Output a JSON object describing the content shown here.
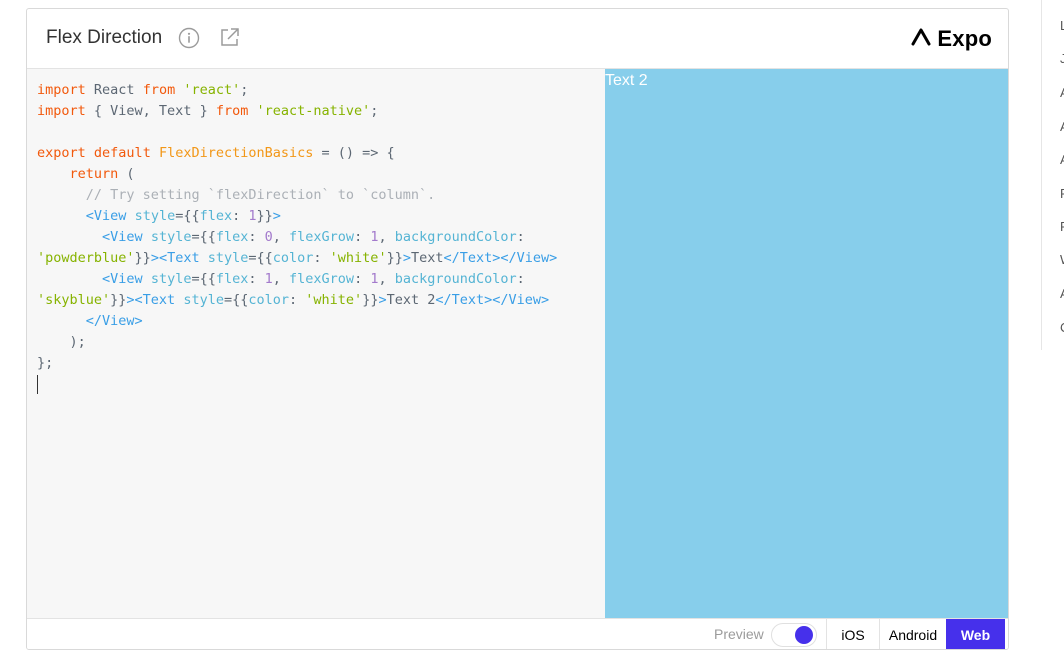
{
  "header": {
    "title": "Flex Direction",
    "brand": "Expo"
  },
  "code": {
    "lines": [
      [
        {
          "t": "import",
          "c": "kw"
        },
        {
          "t": " React ",
          "c": ""
        },
        {
          "t": "from",
          "c": "kw"
        },
        {
          "t": " ",
          "c": ""
        },
        {
          "t": "'react'",
          "c": "str"
        },
        {
          "t": ";",
          "c": ""
        }
      ],
      [
        {
          "t": "import",
          "c": "kw"
        },
        {
          "t": " { View, Text } ",
          "c": ""
        },
        {
          "t": "from",
          "c": "kw"
        },
        {
          "t": " ",
          "c": ""
        },
        {
          "t": "'react-native'",
          "c": "str"
        },
        {
          "t": ";",
          "c": ""
        }
      ],
      [],
      [
        {
          "t": "export",
          "c": "kw"
        },
        {
          "t": " ",
          "c": ""
        },
        {
          "t": "default",
          "c": "kw"
        },
        {
          "t": " ",
          "c": ""
        },
        {
          "t": "FlexDirectionBasics",
          "c": "fn"
        },
        {
          "t": " = () => {",
          "c": ""
        }
      ],
      [
        {
          "t": "    ",
          "c": ""
        },
        {
          "t": "return",
          "c": "kw"
        },
        {
          "t": " (",
          "c": ""
        }
      ],
      [
        {
          "t": "      ",
          "c": ""
        },
        {
          "t": "// Try setting `flexDirection` to `column`.",
          "c": "com"
        }
      ],
      [
        {
          "t": "      ",
          "c": ""
        },
        {
          "t": "<View",
          "c": "tag"
        },
        {
          "t": " ",
          "c": ""
        },
        {
          "t": "style",
          "c": "attr"
        },
        {
          "t": "={{",
          "c": ""
        },
        {
          "t": "flex",
          "c": "attr"
        },
        {
          "t": ": ",
          "c": ""
        },
        {
          "t": "1",
          "c": "num"
        },
        {
          "t": "}}",
          "c": ""
        },
        {
          "t": ">",
          "c": "tag"
        }
      ],
      [
        {
          "t": "        ",
          "c": ""
        },
        {
          "t": "<View",
          "c": "tag"
        },
        {
          "t": " ",
          "c": ""
        },
        {
          "t": "style",
          "c": "attr"
        },
        {
          "t": "={{",
          "c": ""
        },
        {
          "t": "flex",
          "c": "attr"
        },
        {
          "t": ": ",
          "c": ""
        },
        {
          "t": "0",
          "c": "num"
        },
        {
          "t": ", ",
          "c": ""
        },
        {
          "t": "flexGrow",
          "c": "attr"
        },
        {
          "t": ": ",
          "c": ""
        },
        {
          "t": "1",
          "c": "num"
        },
        {
          "t": ", ",
          "c": ""
        },
        {
          "t": "backgroundColor",
          "c": "attr"
        },
        {
          "t": ":",
          "c": ""
        }
      ],
      [
        {
          "t": "'powderblue'",
          "c": "str"
        },
        {
          "t": "}}",
          "c": ""
        },
        {
          "t": "><Text",
          "c": "tag"
        },
        {
          "t": " ",
          "c": ""
        },
        {
          "t": "style",
          "c": "attr"
        },
        {
          "t": "={{",
          "c": ""
        },
        {
          "t": "color",
          "c": "attr"
        },
        {
          "t": ": ",
          "c": ""
        },
        {
          "t": "'white'",
          "c": "str"
        },
        {
          "t": "}}",
          "c": ""
        },
        {
          "t": ">",
          "c": "tag"
        },
        {
          "t": "Text",
          "c": ""
        },
        {
          "t": "</Text></View>",
          "c": "tag"
        }
      ],
      [
        {
          "t": "        ",
          "c": ""
        },
        {
          "t": "<View",
          "c": "tag"
        },
        {
          "t": " ",
          "c": ""
        },
        {
          "t": "style",
          "c": "attr"
        },
        {
          "t": "={{",
          "c": ""
        },
        {
          "t": "flex",
          "c": "attr"
        },
        {
          "t": ": ",
          "c": ""
        },
        {
          "t": "1",
          "c": "num"
        },
        {
          "t": ", ",
          "c": ""
        },
        {
          "t": "flexGrow",
          "c": "attr"
        },
        {
          "t": ": ",
          "c": ""
        },
        {
          "t": "1",
          "c": "num"
        },
        {
          "t": ", ",
          "c": ""
        },
        {
          "t": "backgroundColor",
          "c": "attr"
        },
        {
          "t": ":",
          "c": ""
        }
      ],
      [
        {
          "t": "'skyblue'",
          "c": "str"
        },
        {
          "t": "}}",
          "c": ""
        },
        {
          "t": "><Text",
          "c": "tag"
        },
        {
          "t": " ",
          "c": ""
        },
        {
          "t": "style",
          "c": "attr"
        },
        {
          "t": "={{",
          "c": ""
        },
        {
          "t": "color",
          "c": "attr"
        },
        {
          "t": ": ",
          "c": ""
        },
        {
          "t": "'white'",
          "c": "str"
        },
        {
          "t": "}}",
          "c": ""
        },
        {
          "t": ">",
          "c": "tag"
        },
        {
          "t": "Text 2",
          "c": ""
        },
        {
          "t": "</Text></View>",
          "c": "tag"
        }
      ],
      [
        {
          "t": "      ",
          "c": ""
        },
        {
          "t": "</View>",
          "c": "tag"
        }
      ],
      [
        {
          "t": "    );",
          "c": ""
        }
      ],
      [
        {
          "t": "};",
          "c": ""
        }
      ]
    ]
  },
  "preview": {
    "text": "Text 2",
    "background": "#87ceeb"
  },
  "footer": {
    "preview_label": "Preview",
    "preview_toggle_on": true,
    "platforms": [
      {
        "label": "iOS",
        "selected": false
      },
      {
        "label": "Android",
        "selected": false
      },
      {
        "label": "Web",
        "selected": true
      }
    ]
  },
  "toc": {
    "items": [
      "L",
      "J",
      "A",
      "A",
      "A",
      "F",
      "F",
      "W",
      "A",
      "C"
    ]
  },
  "colors": {
    "accent": "#4630eb"
  }
}
